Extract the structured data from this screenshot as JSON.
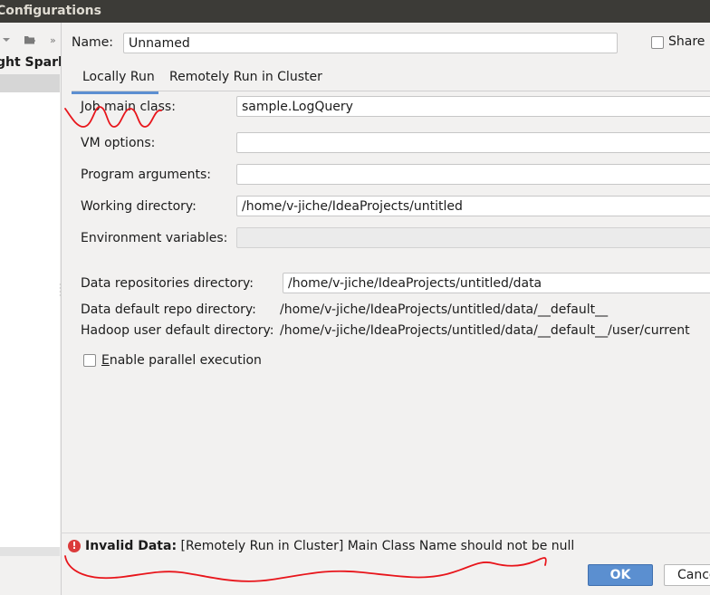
{
  "window": {
    "title": "Configurations"
  },
  "left": {
    "tree_header": "ght Spark",
    "icons": [
      "chevron-down-icon",
      "folder-add-icon",
      "double-chevron-right-icon"
    ]
  },
  "name_row": {
    "label": "Name:",
    "value": "Unnamed",
    "share_label": "Share",
    "share_checked": false
  },
  "tabs": [
    {
      "label": "Locally Run",
      "active": true
    },
    {
      "label": "Remotely Run in Cluster",
      "active": false
    }
  ],
  "form": {
    "job_main_class": {
      "label": "Job main class:",
      "value": "sample.LogQuery"
    },
    "vm_options": {
      "label": "VM options:",
      "value": ""
    },
    "program_arguments": {
      "label": "Program arguments:",
      "value": ""
    },
    "working_directory": {
      "label": "Working directory:",
      "value": "/home/v-jiche/IdeaProjects/untitled"
    },
    "environment_variables": {
      "label": "Environment variables:",
      "value": ""
    },
    "data_repositories_directory": {
      "label": "Data repositories directory:",
      "value": "/home/v-jiche/IdeaProjects/untitled/data"
    },
    "data_default_repo_directory": {
      "label": "Data default repo directory:",
      "value": "/home/v-jiche/IdeaProjects/untitled/data/__default__"
    },
    "hadoop_user_default_directory": {
      "label": "Hadoop user default directory:",
      "value": "/home/v-jiche/IdeaProjects/untitled/data/__default__/user/current"
    },
    "enable_parallel_execution": {
      "label_first": "E",
      "label_rest": "nable parallel execution",
      "checked": false
    }
  },
  "status": {
    "prefix": "Invalid Data:",
    "message": "[Remotely Run in Cluster] Main Class Name should not be null",
    "icon": "error-icon",
    "color": "#db3b3b"
  },
  "buttons": {
    "ok": "OK",
    "cancel": "Cancel"
  },
  "colors": {
    "accent": "#5b8fd0",
    "titlebar": "#3c3b37",
    "annotation": "#e8151b"
  }
}
